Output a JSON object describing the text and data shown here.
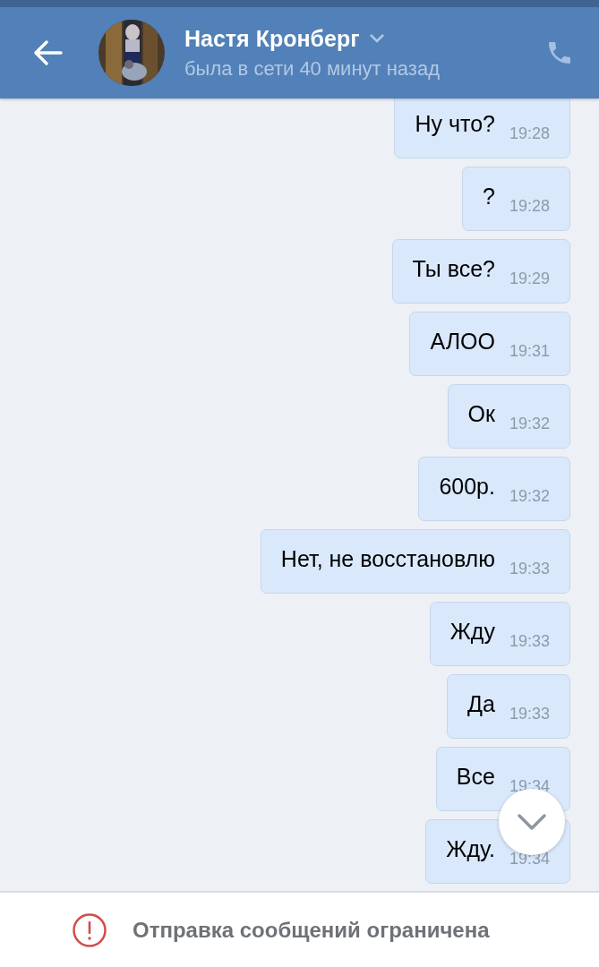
{
  "header": {
    "name": "Настя Кронберг",
    "status": "была в сети 40 минут назад"
  },
  "messages": [
    {
      "text": "Ну что?",
      "time": "19:28"
    },
    {
      "text": "?",
      "time": "19:28"
    },
    {
      "text": "Ты все?",
      "time": "19:29"
    },
    {
      "text": "АЛОО",
      "time": "19:31"
    },
    {
      "text": "Ок",
      "time": "19:32"
    },
    {
      "text": "600р.",
      "time": "19:32"
    },
    {
      "text": "Нет, не восстановлю",
      "time": "19:33"
    },
    {
      "text": "Жду",
      "time": "19:33"
    },
    {
      "text": "Да",
      "time": "19:33"
    },
    {
      "text": "Все",
      "time": "19:34"
    },
    {
      "text": "Жду.",
      "time": "19:34"
    }
  ],
  "footer": {
    "notice": "Отправка сообщений ограничена"
  }
}
